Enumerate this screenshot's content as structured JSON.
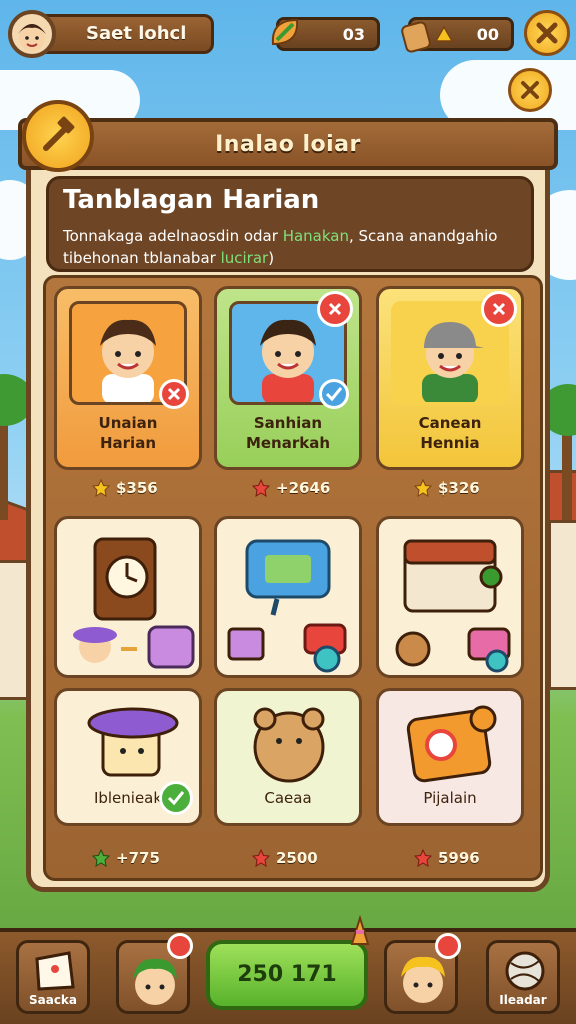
{
  "top_bar": {
    "player_name": "Saet lohcl",
    "currency_1": "03",
    "currency_2": "00"
  },
  "panel": {
    "header_title": "Inalao loiar",
    "quest": {
      "title": "Tanblagan Harian",
      "desc_part1": "Tonnakaga adelnaosdin odar ",
      "desc_highlight1": "Hanakan",
      "desc_part2": ", Scana anandgahio tibehonan tblanabar ",
      "desc_highlight2": "lucirar",
      "desc_part3": ")"
    },
    "characters": [
      {
        "label_line1": "Unaian",
        "label_line2": "Harian",
        "price": "$356",
        "star_color": "#f6c21d"
      },
      {
        "label_line1": "Sanhian",
        "label_line2": "Menarkah",
        "price": "+2646",
        "star_color": "#e8453c"
      },
      {
        "label_line1": "Canean",
        "label_line2": "Hennia",
        "price": "$326",
        "star_color": "#f6c21d"
      }
    ],
    "items": [
      {
        "label": ""
      },
      {
        "label": ""
      },
      {
        "label": ""
      },
      {
        "label": "Iblenieak"
      },
      {
        "label": "Caeaa"
      },
      {
        "label": "Pijalain"
      }
    ],
    "item_prices": [
      {
        "price": "+775",
        "star_color": "#4caf3c"
      },
      {
        "price": "2500",
        "star_color": "#e8453c"
      },
      {
        "price": "5996",
        "star_color": "#e8453c"
      }
    ]
  },
  "bottom_bar": {
    "left_label": "Saacka",
    "center_value": "250 171",
    "right_label": "Ileadar"
  },
  "colors": {
    "wood": "#8a5428",
    "card_orange": "#f5a64a",
    "card_green": "#a7d86a",
    "card_yellow": "#f7d457",
    "accent_red": "#e8453c",
    "gold": "#f0a81e"
  }
}
